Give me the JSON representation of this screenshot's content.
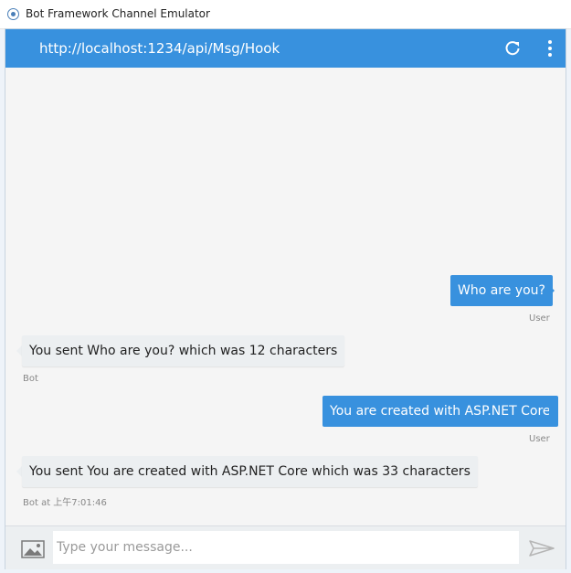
{
  "window": {
    "title": "Bot Framework Channel Emulator"
  },
  "header": {
    "url": "http://localhost:1234/api/Msg/Hook"
  },
  "messages": [
    {
      "from": "user",
      "text": "Who are you?",
      "meta": "User"
    },
    {
      "from": "bot",
      "text": "You sent Who are you? which was 12 characters",
      "meta": "Bot"
    },
    {
      "from": "user",
      "text": "You are created with ASP.NET Core",
      "meta": "User"
    },
    {
      "from": "bot",
      "text": "You sent You are created with ASP.NET Core which was 33 characters",
      "meta": "Bot at 上午7:01:46"
    }
  ],
  "composer": {
    "placeholder": "Type your message..."
  },
  "icons": {
    "app": "bot-framework-icon",
    "refresh": "refresh-icon",
    "menu": "more-vert-icon",
    "attach": "image-upload-icon",
    "send": "send-icon"
  },
  "colors": {
    "accent": "#3891de",
    "bot_bubble": "#eceff1"
  }
}
